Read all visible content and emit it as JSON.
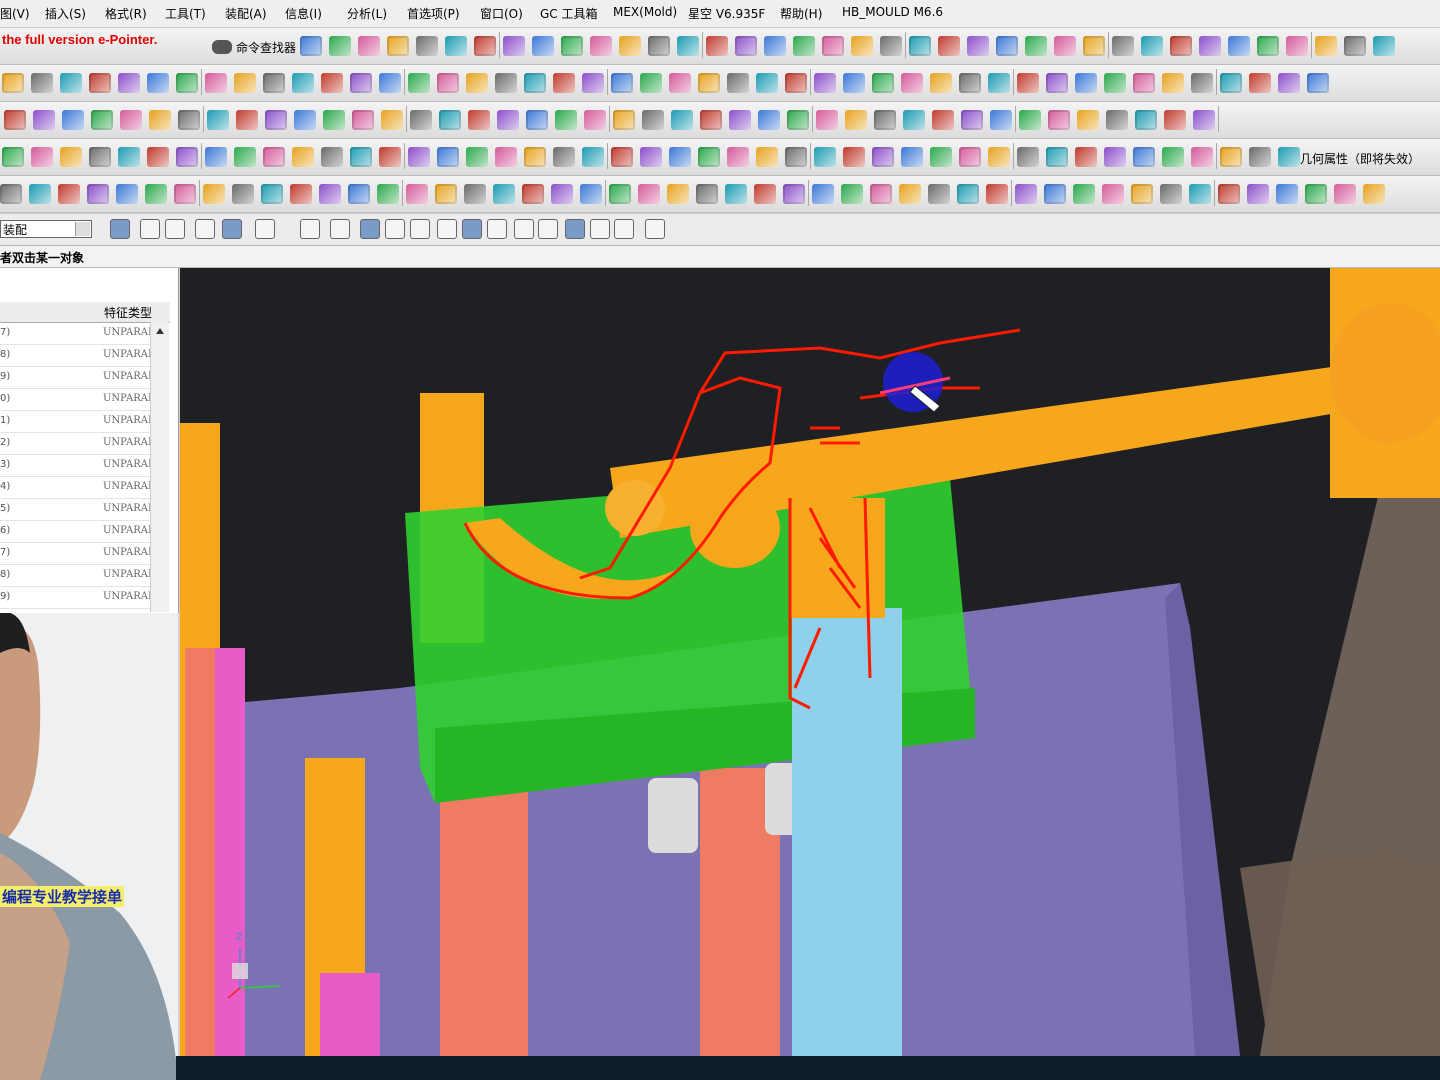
{
  "menu": [
    "图(V)",
    "插入(S)",
    "格式(R)",
    "工具(T)",
    "装配(A)",
    "信息(I)",
    "分析(L)",
    "首选项(P)",
    "窗口(O)",
    "GC 工具箱",
    "MEX(Mold)",
    "星空 V6.935F",
    "帮助(H)",
    "HB_MOULD M6.6"
  ],
  "watermark": "the full version e-Pointer.",
  "toolbar": {
    "command_finder": "命令查找器",
    "geometry_label": "几何属性（即将失效）"
  },
  "selection": {
    "filter": "装配"
  },
  "status": "者双击某一对象",
  "navigator": {
    "column_type": "特征类型",
    "rows": [
      {
        "idx": "7)",
        "type": "UNPARAM"
      },
      {
        "idx": "8)",
        "type": "UNPARAM"
      },
      {
        "idx": "9)",
        "type": "UNPARAM"
      },
      {
        "idx": "0)",
        "type": "UNPARAM"
      },
      {
        "idx": "1)",
        "type": "UNPARAM"
      },
      {
        "idx": "2)",
        "type": "UNPARAM"
      },
      {
        "idx": "3)",
        "type": "UNPARAM"
      },
      {
        "idx": "4)",
        "type": "UNPARAM"
      },
      {
        "idx": "5)",
        "type": "UNPARAM"
      },
      {
        "idx": "6)",
        "type": "UNPARAM"
      },
      {
        "idx": "7)",
        "type": "UNPARAM"
      },
      {
        "idx": "8)",
        "type": "UNPARAM"
      },
      {
        "idx": "9)",
        "type": "UNPARAM"
      }
    ]
  },
  "webcam": {
    "caption": "编程专业教学接单"
  },
  "viewport": {
    "axis_label": "Z"
  },
  "colors": {
    "background": "#1f2024",
    "purple_plate": "#7b72b3",
    "orange": "#f7a71b",
    "green": "#2fd02f",
    "light_blue": "#8fd1ea",
    "pink": "#e85cc8",
    "salmon": "#ee7b62",
    "annotation_red": "#ff1a00",
    "cursor_blue": "#1f1fd6"
  }
}
